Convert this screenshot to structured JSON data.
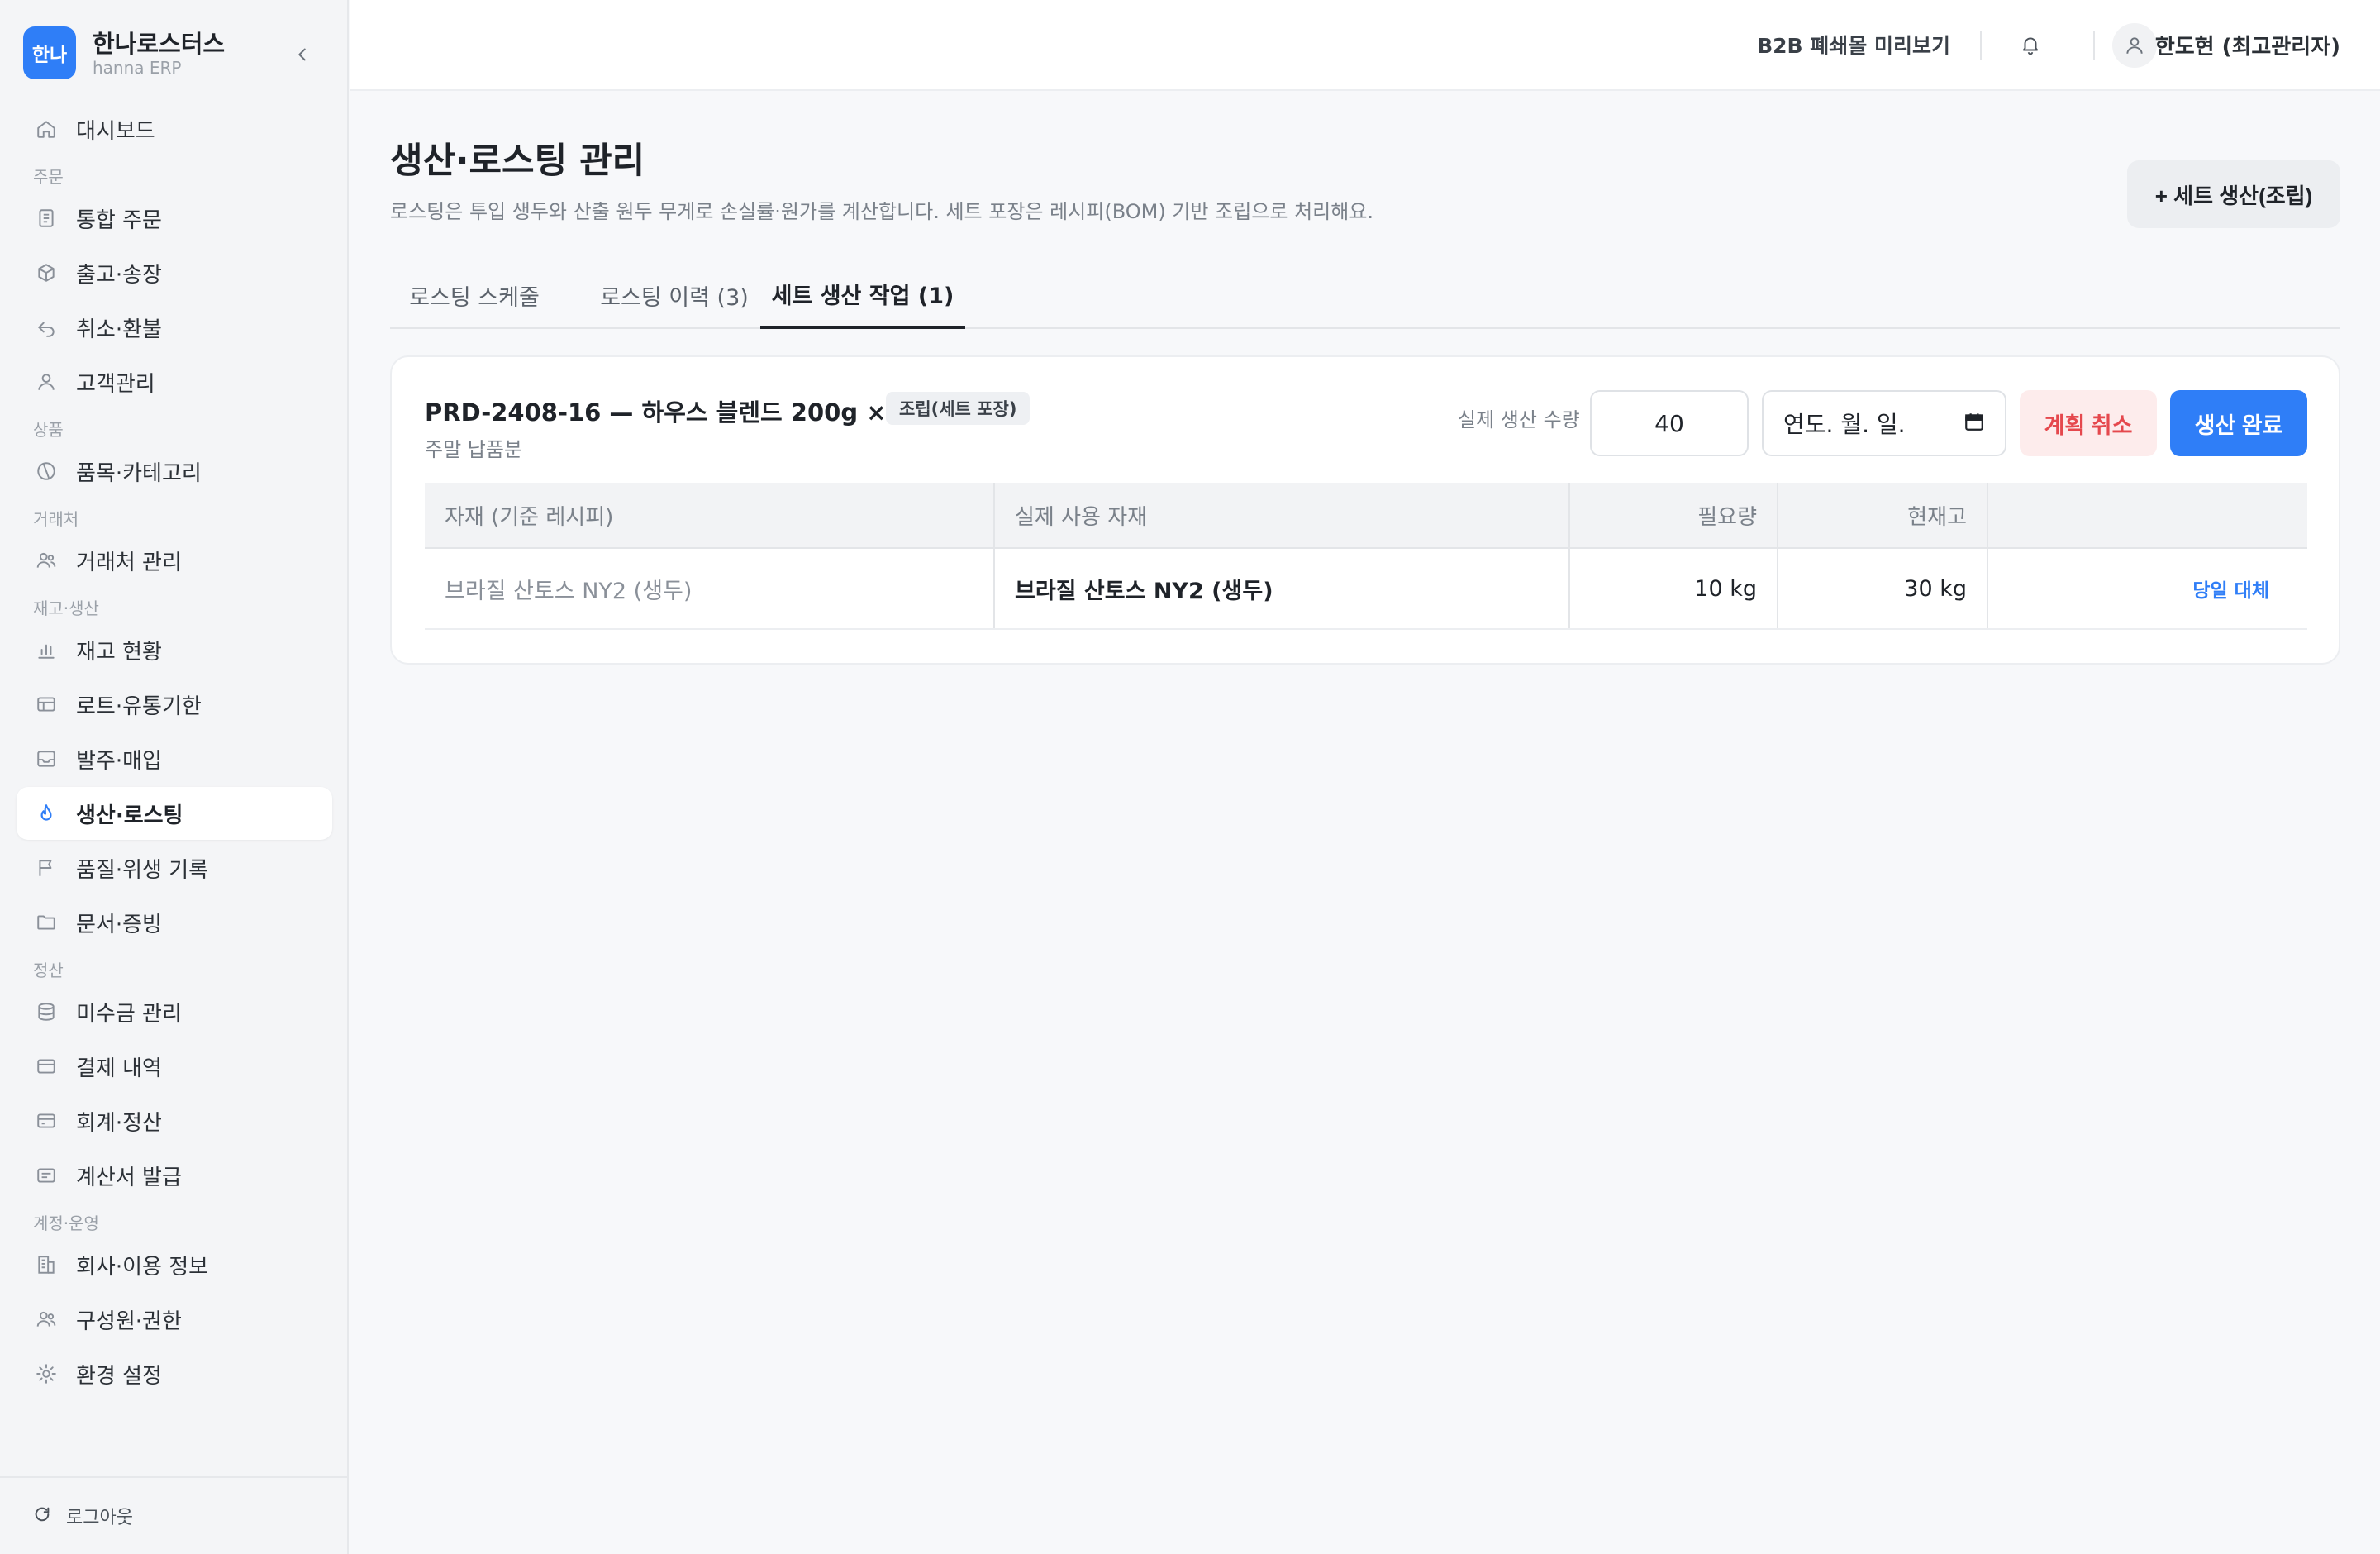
{
  "brand": {
    "logo": "한나",
    "name": "한나로스터스",
    "sub": "hanna ERP"
  },
  "sidebar": {
    "sections": {
      "order": "주문",
      "product": "상품",
      "partner": "거래처",
      "inventory": "재고·생산",
      "settle": "정산",
      "account": "계정·운영"
    },
    "items": [
      {
        "label": "대시보드",
        "icon": "home-icon"
      },
      {
        "label": "통합 주문",
        "icon": "document-icon"
      },
      {
        "label": "출고·송장",
        "icon": "box-icon"
      },
      {
        "label": "취소·환불",
        "icon": "undo-icon"
      },
      {
        "label": "고객관리",
        "icon": "user-icon"
      },
      {
        "label": "품목·카테고리",
        "icon": "tag-icon"
      },
      {
        "label": "거래처 관리",
        "icon": "users-icon"
      },
      {
        "label": "재고 현황",
        "icon": "bar-chart-icon"
      },
      {
        "label": "로트·유통기한",
        "icon": "table-icon"
      },
      {
        "label": "발주·매입",
        "icon": "inbox-icon"
      },
      {
        "label": "생산·로스팅",
        "icon": "flame-icon"
      },
      {
        "label": "품질·위생 기록",
        "icon": "flag-icon"
      },
      {
        "label": "문서·증빙",
        "icon": "folder-icon"
      },
      {
        "label": "미수금 관리",
        "icon": "database-icon"
      },
      {
        "label": "결제 내역",
        "icon": "card-icon"
      },
      {
        "label": "회계·정산",
        "icon": "wallet-icon"
      },
      {
        "label": "계산서 발급",
        "icon": "receipt-icon"
      },
      {
        "label": "회사·이용 정보",
        "icon": "building-icon"
      },
      {
        "label": "구성원·권한",
        "icon": "team-icon"
      },
      {
        "label": "환경 설정",
        "icon": "gear-icon"
      }
    ],
    "logout": "로그아웃"
  },
  "topbar": {
    "b2b": "B2B 폐쇄몰 미리보기",
    "user": "한도현 (최고관리자)"
  },
  "page": {
    "title": "생산·로스팅 관리",
    "desc": "로스팅은 투입 생두와 산출 원두 무게로 손실률·원가를 계산합니다. 세트 포장은 레시피(BOM) 기반 조립으로 처리해요.",
    "new_set_button": "+ 세트 생산(조립)"
  },
  "tabs": [
    {
      "label": "로스팅 스케줄"
    },
    {
      "label": "로스팅 이력 (3)"
    },
    {
      "label": "세트 생산 작업 (1)"
    }
  ],
  "job": {
    "title": "PRD-2408-16 — 하우스 블렌드 200g ×40",
    "badge": "조립(세트 포장)",
    "note": "주말 납품분",
    "qty_label": "실제 생산 수량",
    "qty_value": "40",
    "date_placeholder": "연도. 월. 일.",
    "cancel": "계획 취소",
    "complete": "생산 완료",
    "columns": [
      "자재 (기준 레시피)",
      "실제 사용 자재",
      "필요량",
      "현재고",
      ""
    ],
    "rows": [
      {
        "base": "브라질 산토스 NY2 (생두)",
        "actual": "브라질 산토스 NY2 (생두)",
        "need": "10 kg",
        "stock": "30 kg",
        "action": "당일 대체"
      }
    ]
  },
  "colors": {
    "accent": "#2f7ef7",
    "danger": "#e5484d",
    "danger_bg": "#fdecec"
  }
}
